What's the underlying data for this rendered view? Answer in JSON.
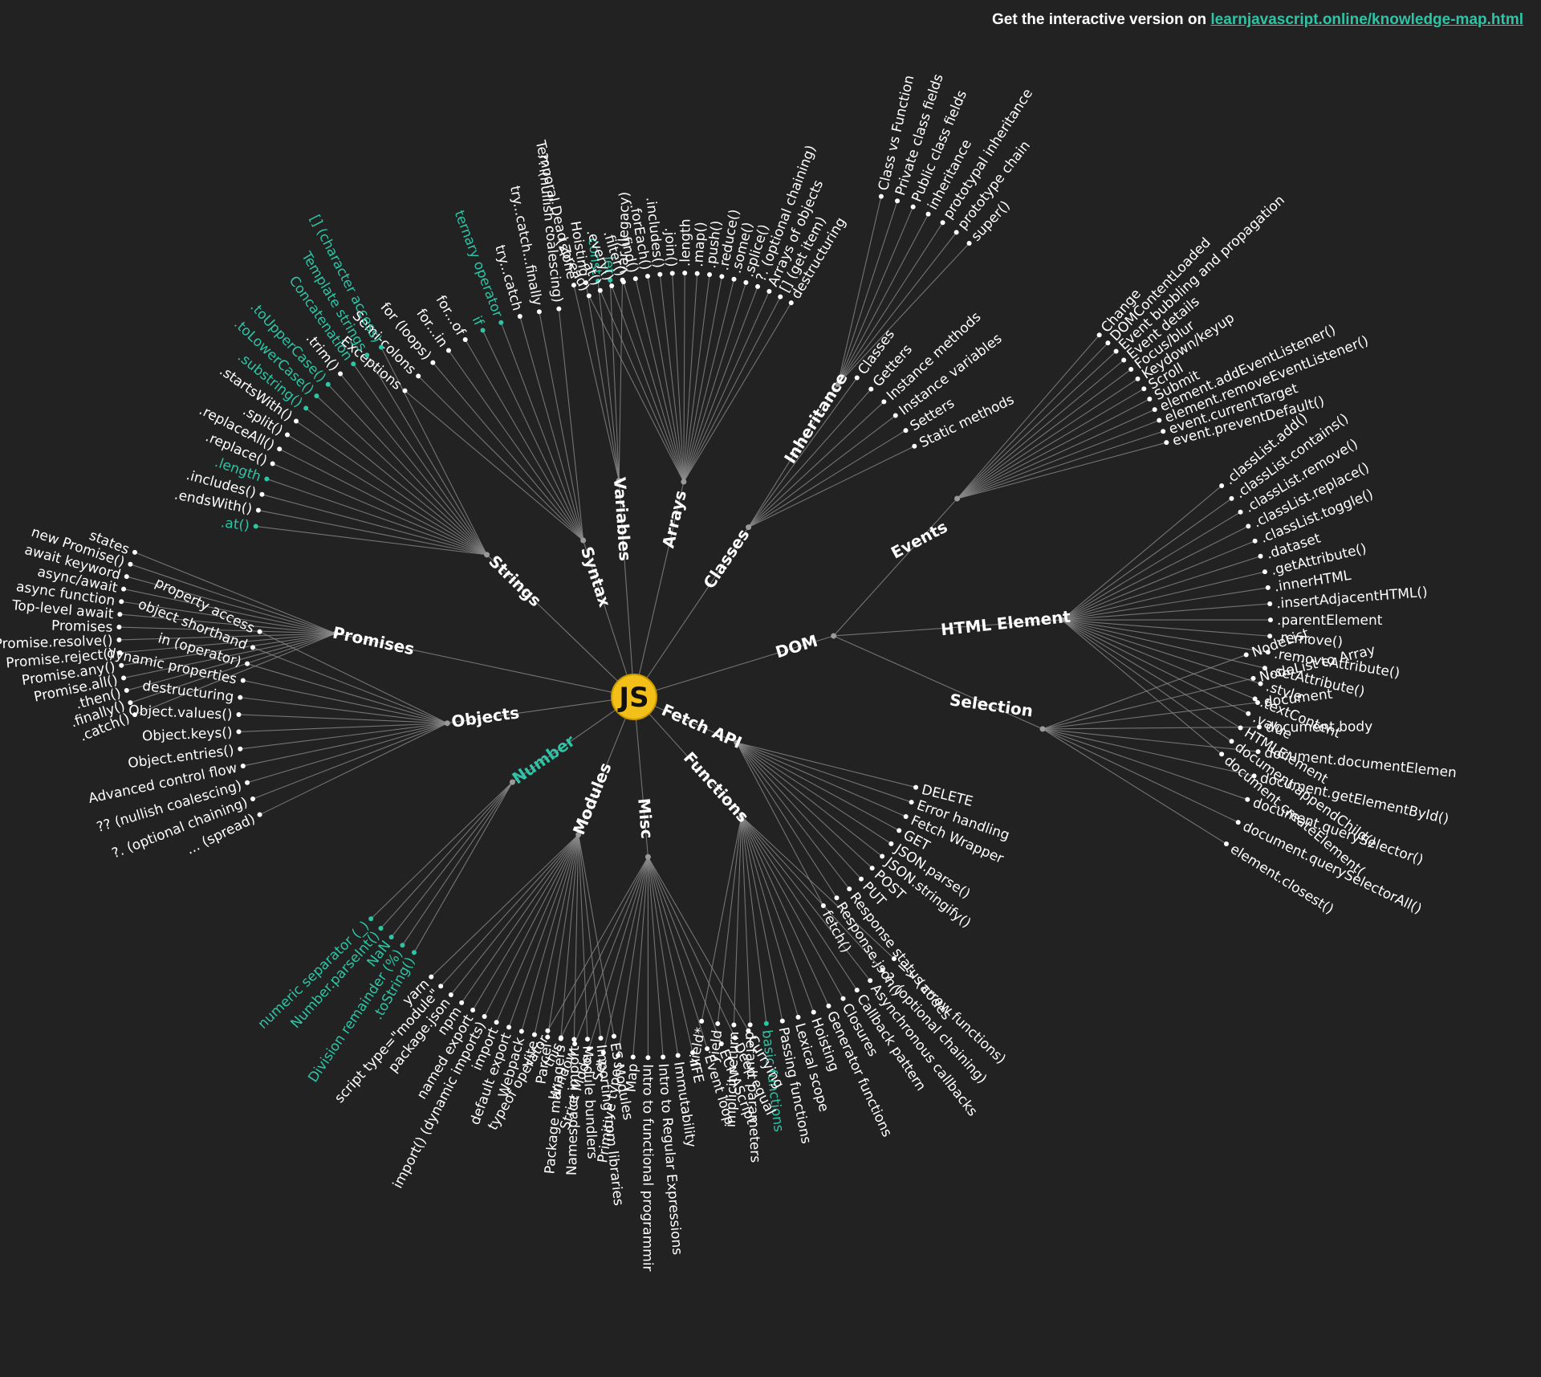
{
  "banner": {
    "text": "Get the interactive version on ",
    "link_text": "learnjavascript.online/knowledge-map.html"
  },
  "colors": {
    "background": "#222222",
    "text": "#ffffff",
    "highlight": "#2ec4a5",
    "center_fill": "#f2c018",
    "edge": "#8a8a8a"
  },
  "center": {
    "label": "JS"
  },
  "branches": [
    {
      "label": "Syntax",
      "leaves": [
        {
          "label": "Exceptions"
        },
        {
          "label": "Semi-colons"
        },
        {
          "label": "for (loops)"
        },
        {
          "label": "for...in"
        },
        {
          "label": "for...of"
        },
        {
          "label": "if",
          "hl": true
        },
        {
          "label": "ternary operator",
          "hl": true
        },
        {
          "label": "try...catch"
        },
        {
          "label": "try...catch...finally"
        },
        {
          "label": "?? (nullish coalescing)"
        }
      ]
    },
    {
      "label": "Variables",
      "leaves": [
        {
          "label": "Temporal Dead Zone"
        },
        {
          "label": "Hoisting"
        },
        {
          "label": "const",
          "hl": true
        },
        {
          "label": "let",
          "hl": true
        },
        {
          "label": "var (legacy)"
        }
      ]
    },
    {
      "label": "Arrays",
      "leaves": [
        {
          "label": "... (spread)"
        },
        {
          "label": ".at()"
        },
        {
          "label": ".every()"
        },
        {
          "label": ".filter()"
        },
        {
          "label": ".find()"
        },
        {
          "label": ".forEach()"
        },
        {
          "label": ".includes()"
        },
        {
          "label": ".join()"
        },
        {
          "label": ".length"
        },
        {
          "label": ".map()"
        },
        {
          "label": ".push()"
        },
        {
          "label": ".reduce()"
        },
        {
          "label": ".some()"
        },
        {
          "label": ".splice()"
        },
        {
          "label": "?. (optional chaining)"
        },
        {
          "label": "Arrays of objects"
        },
        {
          "label": "[] (get item)"
        },
        {
          "label": "destructuring"
        }
      ]
    },
    {
      "label": "Classes",
      "leaves": [
        {
          "label": "Classes"
        },
        {
          "label": "Getters"
        },
        {
          "label": "Instance methods"
        },
        {
          "label": "Instance variables"
        },
        {
          "label": "Setters"
        },
        {
          "label": "Static methods"
        }
      ],
      "sub": {
        "label": "Inheritance",
        "leaves": [
          {
            "label": "Class vs Function"
          },
          {
            "label": "Private class fields"
          },
          {
            "label": "Public class fields"
          },
          {
            "label": "inheritance"
          },
          {
            "label": "prototypal inheritance"
          },
          {
            "label": "prototype chain"
          },
          {
            "label": "super()"
          }
        ]
      }
    },
    {
      "label": "DOM",
      "leaves": [],
      "subs": [
        {
          "label": "Events",
          "leaves": [
            {
              "label": "Change"
            },
            {
              "label": "DOMContentLoaded"
            },
            {
              "label": "Event bubbling and propagation"
            },
            {
              "label": "Event details"
            },
            {
              "label": "Focus/blur"
            },
            {
              "label": "Keydown/keyup"
            },
            {
              "label": "Scroll"
            },
            {
              "label": "Submit"
            },
            {
              "label": "element.addEventListener()"
            },
            {
              "label": "element.removeEventListener()"
            },
            {
              "label": "event.currentTarget"
            },
            {
              "label": "event.preventDefault()"
            }
          ]
        },
        {
          "label": "HTML Element",
          "leaves": [
            {
              "label": ".classList.add()"
            },
            {
              "label": ".classList.contains()"
            },
            {
              "label": ".classList.remove()"
            },
            {
              "label": ".classList.replace()"
            },
            {
              "label": ".classList.toggle()"
            },
            {
              "label": ".dataset"
            },
            {
              "label": ".getAttribute()"
            },
            {
              "label": ".innerHTML"
            },
            {
              "label": ".insertAdjacentHTML()"
            },
            {
              "label": ".parentElement"
            },
            {
              "label": ".remove()"
            },
            {
              "label": ".removeAttribute()"
            },
            {
              "label": ".setAttribute()"
            },
            {
              "label": ".style"
            },
            {
              "label": ".textContent"
            },
            {
              "label": ".value"
            },
            {
              "label": "HTMLElement"
            },
            {
              "label": "document.appendChild()"
            },
            {
              "label": "document.createElement("
            }
          ]
        },
        {
          "label": "Selection",
          "leaves": [
            {
              "label": "NodeList"
            },
            {
              "label": "NodeList to Array"
            },
            {
              "label": "document"
            },
            {
              "label": "document.body"
            },
            {
              "label": "document.documentElemen"
            },
            {
              "label": "document.getElementById()"
            },
            {
              "label": "document.querySelector()"
            },
            {
              "label": "document.querySelectorAll()"
            },
            {
              "label": "element.closest()"
            }
          ]
        }
      ]
    },
    {
      "label": "Fetch API",
      "leaves": [
        {
          "label": "DELETE"
        },
        {
          "label": "Error handling"
        },
        {
          "label": "Fetch Wrapper"
        },
        {
          "label": "GET"
        },
        {
          "label": "JSON.parse()"
        },
        {
          "label": "JSON.stringify()"
        },
        {
          "label": "POST"
        },
        {
          "label": "PUT"
        },
        {
          "label": "Response status codes"
        },
        {
          "label": "Response.json()"
        },
        {
          "label": "fetch()"
        }
      ]
    },
    {
      "label": "Functions",
      "leaves": [
        {
          "label": "=> (arrow functions)"
        },
        {
          "label": "?. (optional chaining)"
        },
        {
          "label": "Asynchronous callbacks"
        },
        {
          "label": "Callback pattern"
        },
        {
          "label": "Closures"
        },
        {
          "label": "Generator functions"
        },
        {
          "label": "Hoisting"
        },
        {
          "label": "Lexical scope"
        },
        {
          "label": "Passing functions"
        },
        {
          "label": "basic functions",
          "hl": true
        },
        {
          "label": "default parameters"
        },
        {
          "label": "implicit return"
        },
        {
          "label": "yield"
        },
        {
          "label": "yield*"
        }
      ]
    },
    {
      "label": "Misc",
      "leaves": [
        {
          "label": "Currying"
        },
        {
          "label": "Deep equal"
        },
        {
          "label": "ECMAScript"
        },
        {
          "label": "Event loop"
        },
        {
          "label": "IIFE"
        },
        {
          "label": "Immutability"
        },
        {
          "label": "Intro to Regular Expressions"
        },
        {
          "label": "Intro to functional programmir"
        },
        {
          "label": "Map"
        },
        {
          "label": "Primitive types"
        },
        {
          "label": "Set"
        },
        {
          "label": "Strict Mode"
        },
        {
          "label": "Window"
        },
        {
          "label": "this"
        },
        {
          "label": "typeof operator"
        }
      ]
    },
    {
      "label": "Modules",
      "leaves": [
        {
          "label": "ES Modules"
        },
        {
          "label": "Importing from libraries"
        },
        {
          "label": "Module bundlers"
        },
        {
          "label": "Namespace import"
        },
        {
          "label": "Package managers"
        },
        {
          "label": "Parcel"
        },
        {
          "label": "Vite"
        },
        {
          "label": "Webpack"
        },
        {
          "label": "default export"
        },
        {
          "label": "import"
        },
        {
          "label": "import() (dynamic imports)"
        },
        {
          "label": "named export"
        },
        {
          "label": "npm"
        },
        {
          "label": "package.json"
        },
        {
          "label": "script type=\"module\""
        },
        {
          "label": "yarn"
        }
      ]
    },
    {
      "label": "Number",
      "hl": true,
      "leaves": [
        {
          "label": ".toString()",
          "hl": true
        },
        {
          "label": "Division remainder (%)",
          "hl": true
        },
        {
          "label": "NaN",
          "hl": true
        },
        {
          "label": "Number.parseInt()",
          "hl": true
        },
        {
          "label": "numeric separator (_)",
          "hl": true
        }
      ]
    },
    {
      "label": "Objects",
      "leaves": [
        {
          "label": "... (spread)"
        },
        {
          "label": "?. (optional chaining)"
        },
        {
          "label": "?? (nullish coalescing)"
        },
        {
          "label": "Advanced control flow"
        },
        {
          "label": "Object.entries()"
        },
        {
          "label": "Object.keys()"
        },
        {
          "label": "Object.values()"
        },
        {
          "label": "destructuring"
        },
        {
          "label": "dynamic properties"
        },
        {
          "label": "in (operator)"
        },
        {
          "label": "object shorthand"
        },
        {
          "label": "property access"
        }
      ]
    },
    {
      "label": "Promises",
      "leaves": [
        {
          "label": ".catch()"
        },
        {
          "label": ".finally()"
        },
        {
          "label": ".then()"
        },
        {
          "label": "Promise.all()"
        },
        {
          "label": "Promise.any()"
        },
        {
          "label": "Promise.reject()"
        },
        {
          "label": "Promise.resolve()"
        },
        {
          "label": "Promises"
        },
        {
          "label": "Top-level await"
        },
        {
          "label": "async function"
        },
        {
          "label": "async/await"
        },
        {
          "label": "await keyword"
        },
        {
          "label": "new Promise()"
        },
        {
          "label": "states"
        }
      ]
    },
    {
      "label": "Strings",
      "leaves": [
        {
          "label": ".at()",
          "hl": true
        },
        {
          "label": ".endsWith()"
        },
        {
          "label": ".includes()"
        },
        {
          "label": ".length",
          "hl": true
        },
        {
          "label": ".replace()"
        },
        {
          "label": ".replaceAll()"
        },
        {
          "label": ".split()"
        },
        {
          "label": ".startsWith()"
        },
        {
          "label": ".substring()",
          "hl": true
        },
        {
          "label": ".toLowerCase()",
          "hl": true
        },
        {
          "label": ".toUpperCase()",
          "hl": true
        },
        {
          "label": ".trim()"
        },
        {
          "label": "Concatenation",
          "hl": true
        },
        {
          "label": "Template strings",
          "hl": true
        },
        {
          "label": "[] (character access)",
          "hl": true
        }
      ]
    }
  ]
}
